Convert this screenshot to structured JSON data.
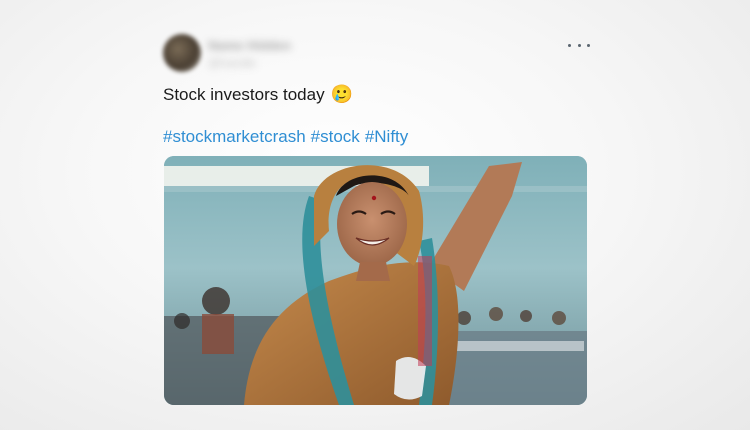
{
  "tweet": {
    "author": {
      "display_name": "Name Hidden",
      "handle": "@handle"
    },
    "text": "Stock investors today",
    "emoji": "🥲",
    "hashtags": [
      "#stockmarketcrash",
      "#stock",
      "#Nifty"
    ],
    "more_icon": "more-horizontal-icon"
  },
  "colors": {
    "hashtag": "#2f8ed3",
    "text": "#1b1b1b"
  }
}
